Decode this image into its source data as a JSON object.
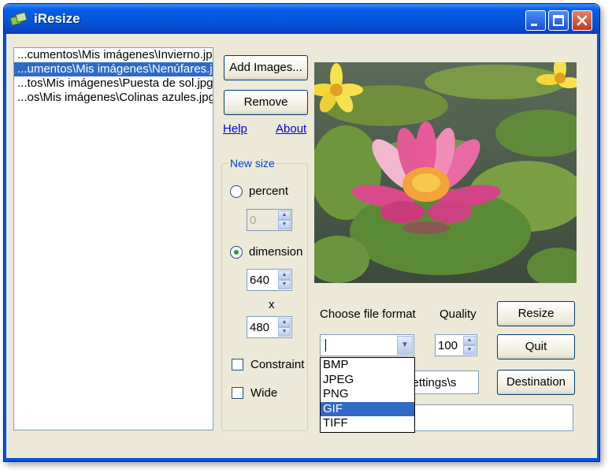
{
  "window": {
    "title": "iResize"
  },
  "files": [
    "...cumentos\\Mis imágenes\\Invierno.jpg",
    "...umentos\\Mis imágenes\\Nenúfares.jpg",
    "...tos\\Mis imágenes\\Puesta de sol.jpg",
    "...os\\Mis imágenes\\Colinas azules.jpg"
  ],
  "selected_file_index": 1,
  "buttons": {
    "add_images": "Add Images...",
    "remove": "Remove",
    "resize": "Resize",
    "quit": "Quit",
    "destination": "Destination"
  },
  "links": {
    "help": "Help",
    "about": "About"
  },
  "new_size": {
    "title": "New size",
    "percent_label": "percent",
    "percent_value": "0",
    "dimension_label": "dimension",
    "selected_mode": "dimension",
    "width": "640",
    "x_label": "x",
    "height": "480",
    "constraint_label": "Constraint",
    "wide_label": "Wide"
  },
  "format": {
    "label": "Choose file format",
    "options": [
      "BMP",
      "JPEG",
      "PNG",
      "GIF",
      "TIFF"
    ],
    "highlighted_option": "GIF"
  },
  "quality": {
    "label": "Quality",
    "value": "100"
  },
  "settings_field": {
    "visible_text": "d Settings\\s"
  },
  "colors": {
    "titlebar": "#0553dc",
    "window_bg": "#ece9d8",
    "selection": "#316ac5",
    "link": "#0000ee"
  }
}
